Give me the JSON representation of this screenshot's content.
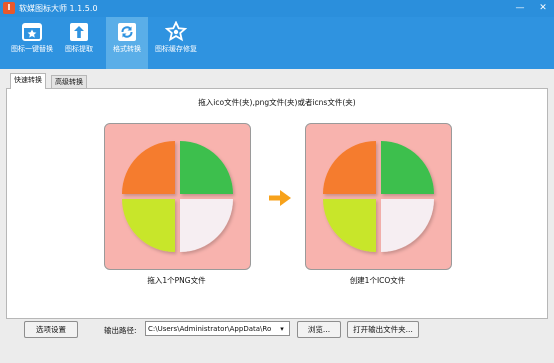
{
  "window": {
    "title": "软媒图标大师 1.1.5.0",
    "app_icon": "I",
    "minimize_glyph": "—",
    "close_glyph": "✕"
  },
  "toolbar": {
    "items": [
      {
        "label": "图标一键替换",
        "icon": "star-window-icon",
        "active": false
      },
      {
        "label": "图标提取",
        "icon": "upload-arrow-icon",
        "active": false
      },
      {
        "label": "格式转换",
        "icon": "refresh-icon",
        "active": true
      },
      {
        "label": "图标缓存修复",
        "icon": "star-wrench-icon",
        "active": false
      }
    ]
  },
  "tabs": [
    {
      "label": "快速转换",
      "selected": true
    },
    {
      "label": "高级转换",
      "selected": false
    }
  ],
  "main": {
    "hint": "拖入ico文件(夹),png文件(夹)或者icns文件(夹)",
    "left_caption": "拖入1个PNG文件",
    "right_caption": "创建1个ICO文件",
    "tile_color": "#f8b3ae",
    "petal_colors": [
      "#f57c2d",
      "#3cbf4d",
      "#c8e62c",
      "#f6eef2"
    ],
    "arrow_color": "#f7a21b"
  },
  "bottom": {
    "options_button": "选项设置",
    "output_label": "输出路径:",
    "output_path": "C:\\Users\\Administrator\\AppData\\Ro",
    "browse_button": "浏览...",
    "open_folder_button": "打开输出文件夹..."
  }
}
